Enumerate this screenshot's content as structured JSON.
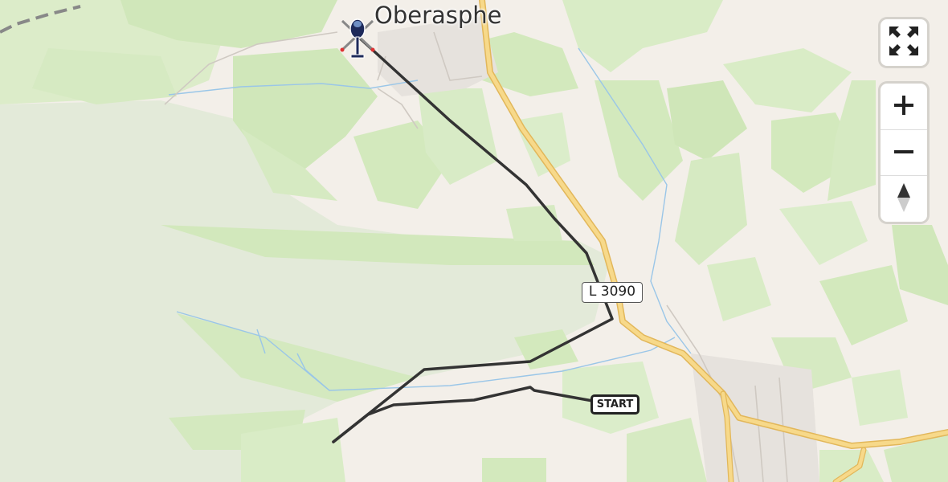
{
  "map": {
    "place_label": "Oberasphe",
    "road_ref": "L 3090",
    "start_label": "START",
    "colors": {
      "background": "#f3efe9",
      "forest": "#d7ebc5",
      "forest_light": "#e3eeda",
      "major_road": "#f7d98a",
      "major_road_casing": "#e2b75a",
      "minor_road": "#ffffff",
      "water": "#9ac6e8",
      "route": "#333333",
      "rail": "#888888"
    },
    "icons": {
      "helicopter": "helicopter-icon",
      "fullscreen": "fullscreen-icon",
      "zoom_in": "zoom-in-icon",
      "zoom_out": "zoom-out-icon",
      "compass": "compass-icon"
    }
  }
}
